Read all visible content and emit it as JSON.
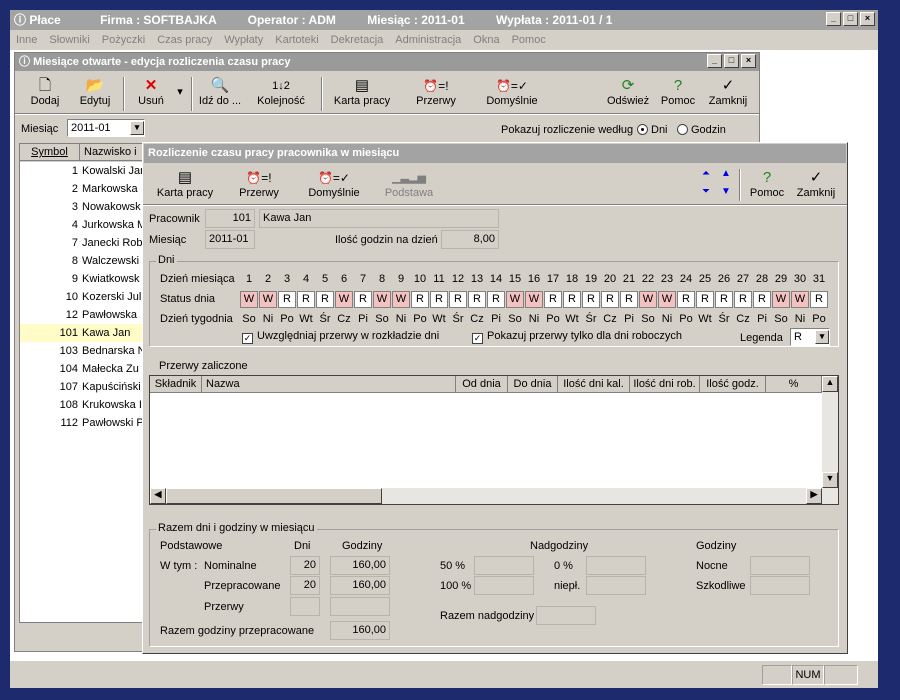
{
  "app": {
    "title": "Płace",
    "firma": "Firma : SOFTBAJKA",
    "operator": "Operator : ADM",
    "miesiac": "Miesiąc : 2011-01",
    "wyplata": "Wypłata : 2011-01 / 1"
  },
  "menu": [
    "Inne",
    "Słowniki",
    "Pożyczki",
    "Czas pracy",
    "Wypłaty",
    "Kartoteki",
    "Dekretacja",
    "Administracja",
    "Okna",
    "Pomoc"
  ],
  "win1": {
    "title": "Miesiące otwarte - edycja rozliczenia czasu pracy",
    "toolbar": {
      "dodaj": "Dodaj",
      "edytuj": "Edytuj",
      "usun": "Usuń",
      "idz": "Idź do ...",
      "kolejnosc": "Kolejność",
      "karta": "Karta pracy",
      "przerwy": "Przerwy",
      "domyslnie": "Domyślnie",
      "odswiez": "Odśwież",
      "pomoc": "Pomoc",
      "zamknij": "Zamknij"
    },
    "miesiac_label": "Miesiąc",
    "miesiac_value": "2011-01",
    "pokazuj": "Pokazuj rozliczenie według",
    "dni": "Dni",
    "godzin": "Godzin",
    "col_symbol": "Symbol",
    "col_nazwisko": "Nazwisko i",
    "rows": [
      {
        "s": "1",
        "n": "Kowalski Jan"
      },
      {
        "s": "2",
        "n": "Markowska"
      },
      {
        "s": "3",
        "n": "Nowakowsk"
      },
      {
        "s": "4",
        "n": "Jurkowska M"
      },
      {
        "s": "7",
        "n": "Janecki Rob"
      },
      {
        "s": "8",
        "n": "Walczewski"
      },
      {
        "s": "9",
        "n": "Kwiatkowsk"
      },
      {
        "s": "10",
        "n": "Kozerski Juli"
      },
      {
        "s": "12",
        "n": "Pawłowska"
      },
      {
        "s": "101",
        "n": "Kawa Jan"
      },
      {
        "s": "103",
        "n": "Bednarska N"
      },
      {
        "s": "104",
        "n": "Małecka Zu"
      },
      {
        "s": "107",
        "n": "Kapuściński"
      },
      {
        "s": "108",
        "n": "Krukowska I"
      },
      {
        "s": "112",
        "n": "Pawłowski P"
      }
    ]
  },
  "win2": {
    "title": "Rozliczenie czasu pracy pracownika w miesiącu",
    "toolbar": {
      "karta": "Karta pracy",
      "przerwy": "Przerwy",
      "domyslnie": "Domyślnie",
      "podstawa": "Podstawa",
      "pomoc": "Pomoc",
      "zamknij": "Zamknij"
    },
    "pracownik_label": "Pracownik",
    "pracownik_nr": "101",
    "pracownik_name": "Kawa Jan",
    "miesiac_label": "Miesiąc",
    "miesiac_value": "2011-01",
    "ilosc_label": "Ilość godzin na dzień",
    "ilosc_value": "8,00",
    "dni_group": "Dni",
    "dzien_mies_label": "Dzień miesiąca",
    "status_label": "Status dnia",
    "dzien_tyg_label": "Dzień tygodnia",
    "days": [
      "1",
      "2",
      "3",
      "4",
      "5",
      "6",
      "7",
      "8",
      "9",
      "10",
      "11",
      "12",
      "13",
      "14",
      "15",
      "16",
      "17",
      "18",
      "19",
      "20",
      "21",
      "22",
      "23",
      "24",
      "25",
      "26",
      "27",
      "28",
      "29",
      "30",
      "31"
    ],
    "status": [
      "W",
      "W",
      "R",
      "R",
      "R",
      "W",
      "R",
      "W",
      "W",
      "R",
      "R",
      "R",
      "R",
      "R",
      "W",
      "W",
      "R",
      "R",
      "R",
      "R",
      "R",
      "W",
      "W",
      "R",
      "R",
      "R",
      "R",
      "R",
      "W",
      "W",
      "R"
    ],
    "weekdays": [
      "So",
      "Ni",
      "Po",
      "Wt",
      "Śr",
      "Cz",
      "Pi",
      "So",
      "Ni",
      "Po",
      "Wt",
      "Śr",
      "Cz",
      "Pi",
      "So",
      "Ni",
      "Po",
      "Wt",
      "Śr",
      "Cz",
      "Pi",
      "So",
      "Ni",
      "Po",
      "Wt",
      "Śr",
      "Cz",
      "Pi",
      "So",
      "Ni",
      "Po"
    ],
    "uwzgl": "Uwzględniaj przerwy w rozkładzie dni",
    "pokazuj_przerwy": "Pokazuj przerwy tylko dla dni roboczych",
    "legenda_label": "Legenda",
    "legenda_value": "R",
    "przerwy_group": "Przerwy zaliczone",
    "grid_cols": [
      "Składnik",
      "Nazwa",
      "Od dnia",
      "Do dnia",
      "Ilość dni kal.",
      "Ilość dni rob.",
      "Ilość godz.",
      "%"
    ],
    "razem_group": "Razem dni i godziny w miesiącu",
    "podstawowe": "Podstawowe",
    "dni_h": "Dni",
    "godziny_h": "Godziny",
    "wtym": "W tym :",
    "nominalne": "Nominalne",
    "nom_dni": "20",
    "nom_godz": "160,00",
    "przepracowane": "Przepracowane",
    "prz_dni": "20",
    "prz_godz": "160,00",
    "przerwy": "Przerwy",
    "razem_godz_label": "Razem godziny przepracowane",
    "razem_godz": "160,00",
    "nadgodziny": "Nadgodziny",
    "p50": "50 %",
    "p100": "100 %",
    "p0": "0 %",
    "niepl": "niepł.",
    "razem_nadg": "Razem nadgodziny",
    "godziny2": "Godziny",
    "nocne": "Nocne",
    "szkodliwe": "Szkodliwe"
  },
  "status": {
    "num": "NUM"
  }
}
